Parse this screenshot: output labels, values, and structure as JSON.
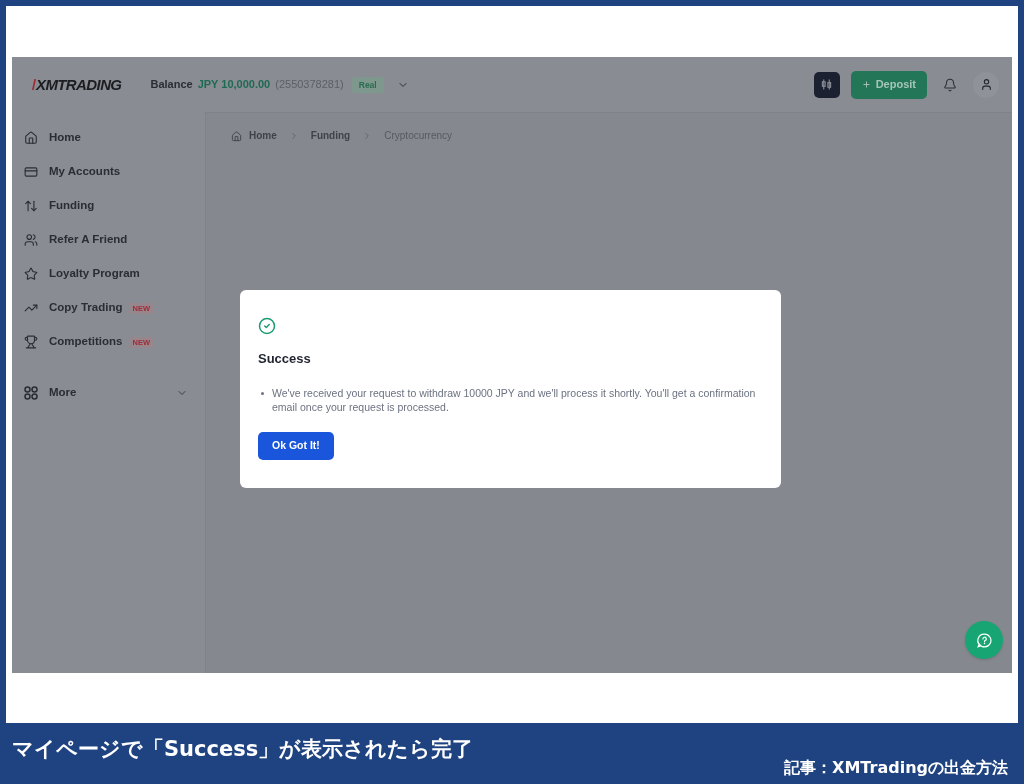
{
  "header": {
    "logo": "XMTRADING",
    "balance_label": "Balance",
    "balance_amount": "JPY 10,000.00",
    "account_number": "(2550378281)",
    "account_badge": "Real",
    "deposit_button": "Deposit"
  },
  "sidebar": {
    "items": [
      {
        "label": "Home",
        "selected": false
      },
      {
        "label": "My Accounts",
        "selected": false
      },
      {
        "label": "Funding",
        "selected": false
      },
      {
        "label": "Refer A Friend",
        "selected": false
      },
      {
        "label": "Loyalty Program",
        "selected": false
      },
      {
        "label": "Copy Trading",
        "badge": "NEW",
        "selected": false
      },
      {
        "label": "Competitions",
        "badge": "NEW",
        "selected": false
      }
    ],
    "more": {
      "label": "More",
      "expanded": false
    }
  },
  "breadcrumb": [
    {
      "label": "Home"
    },
    {
      "label": "Funding"
    },
    {
      "label": "Cryptocurrency"
    }
  ],
  "dialog": {
    "title": "Success",
    "messages": [
      "We've received your request to withdraw 10000 JPY and we'll process it shortly. You'll get a confirmation email once your request is processed."
    ],
    "button": "Ok Got It!"
  },
  "caption_bar": {
    "caption": "マイページで「Success」が表示されたら完了",
    "source_note": "記事：XMTradingの出金方法"
  }
}
